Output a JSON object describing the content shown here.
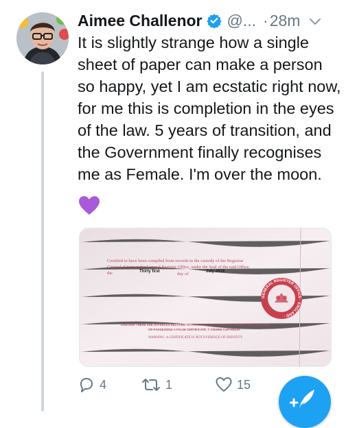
{
  "tweet": {
    "author_name": "Aimee Challenor",
    "handle": "@...",
    "separator": "·",
    "time": "28m",
    "text": "It is slightly strange how a single sheet of paper can make a person so happy, yet I am ecstatic right now, for me this is completion in the eyes of the law. 5 years of transition, and the Government finally recognises me as Female. I'm over the moon.",
    "emoji": "purple-heart"
  },
  "certificate": {
    "line1": "Certified  to  have  been  compiled  from  records  in  the  custody  of  the  Registrar",
    "line2": "General. Given at the General Register Office, under the Seal of the said Office,",
    "line3_the": "the",
    "line3_dayof": "day of",
    "filled_day": "Thirty first",
    "filled_date": "July 2019",
    "caution1": "CAUTION: THERE ARE OFFENCES RELATING TO FALSIFYING OR ALTERING A CERTIFICATE AND USING",
    "caution2": "OR POSSESSING A FALSE CERTIFICATE.  © CROWN COPYRIGHT",
    "warning": "WARNING: A CERTIFICATE IS NOT EVIDENCE OF IDENTITY.",
    "seal_text": "GENERAL REGISTER OFFICE · ENGLAND ·"
  },
  "actions": {
    "reply_count": "4",
    "retweet_count": "1",
    "like_count": "15"
  },
  "colors": {
    "accent": "#1da1f2",
    "muted": "#657786",
    "thread_line": "#cfd6dd",
    "emoji": "#a95ad8"
  }
}
